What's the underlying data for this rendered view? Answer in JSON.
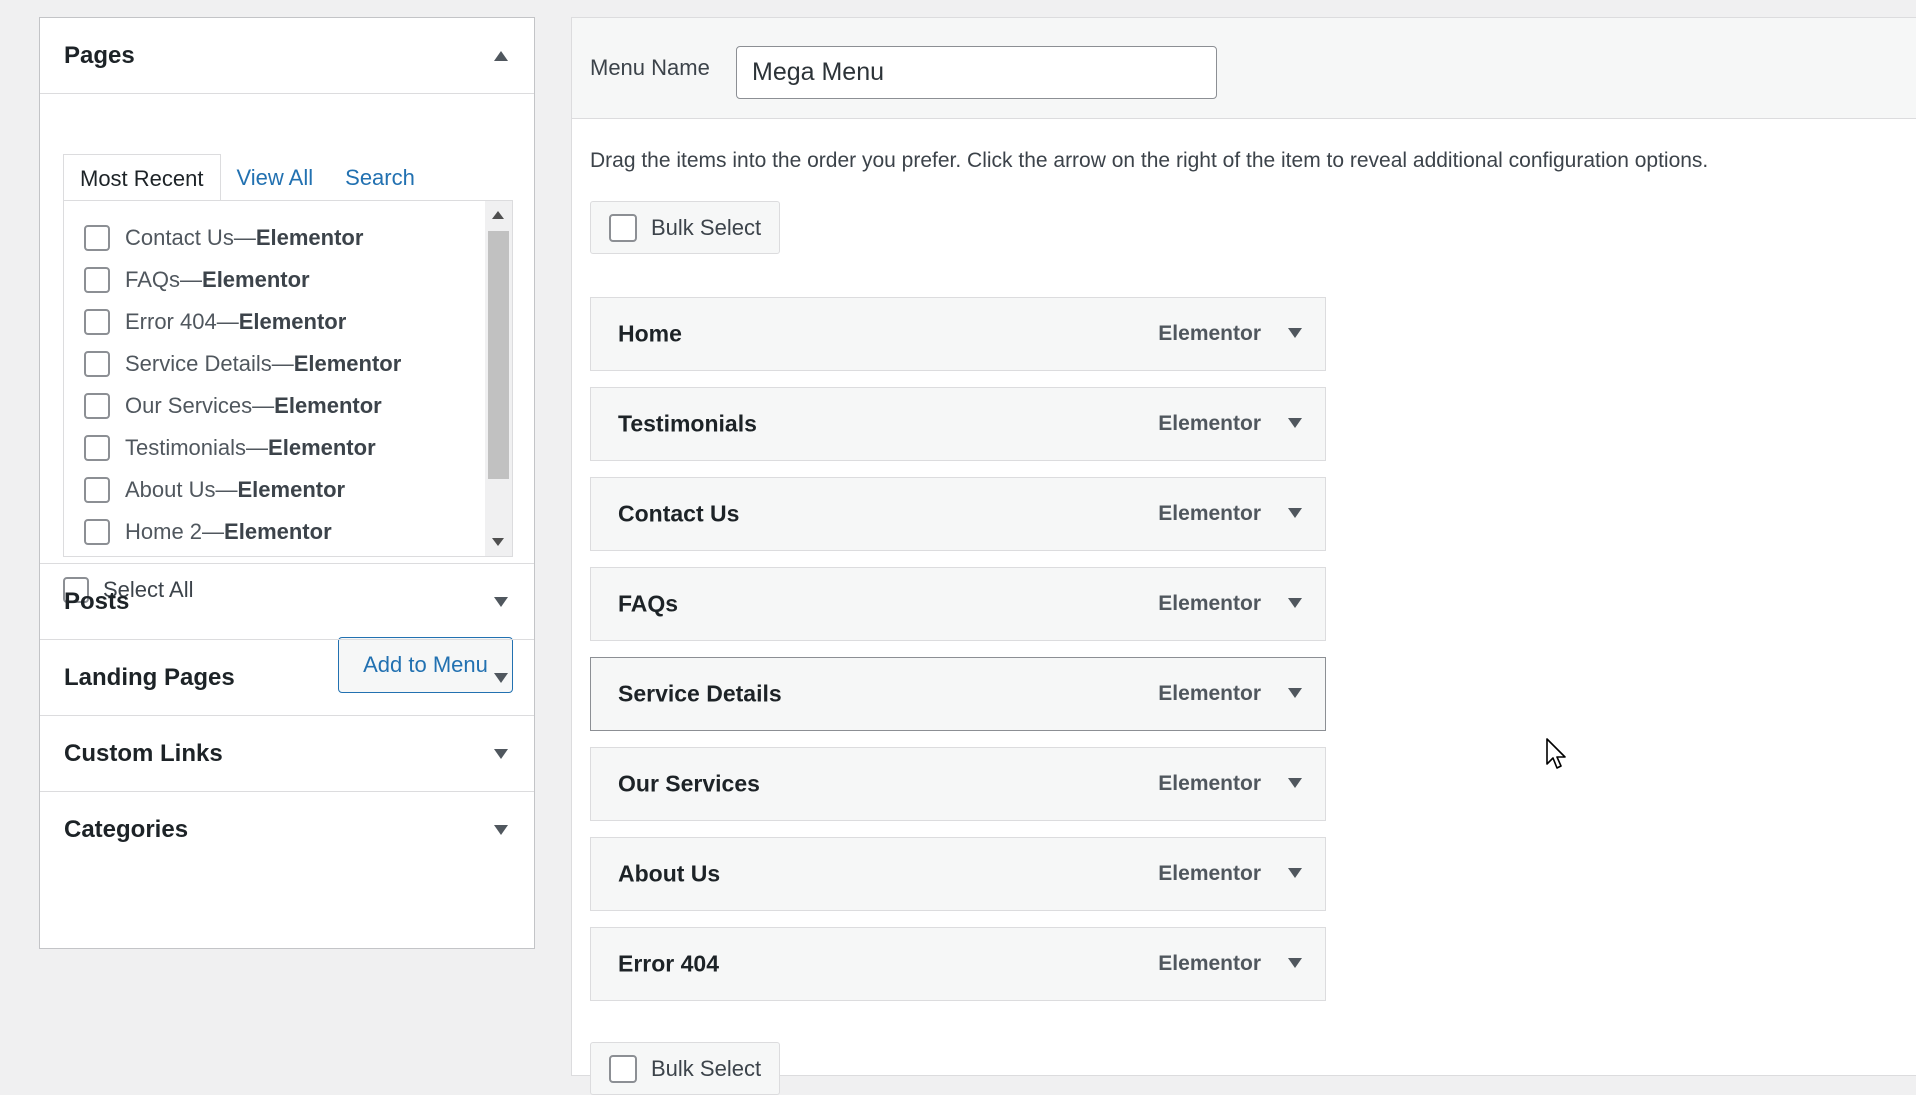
{
  "left": {
    "pages": {
      "title": "Pages",
      "tabs": [
        "Most Recent",
        "View All",
        "Search"
      ],
      "items": [
        {
          "name": "Contact Us",
          "suffix": "Elementor"
        },
        {
          "name": "FAQs",
          "suffix": "Elementor"
        },
        {
          "name": "Error 404",
          "suffix": "Elementor"
        },
        {
          "name": "Service Details",
          "suffix": "Elementor"
        },
        {
          "name": "Our Services",
          "suffix": "Elementor"
        },
        {
          "name": "Testimonials",
          "suffix": "Elementor"
        },
        {
          "name": "About Us",
          "suffix": "Elementor"
        },
        {
          "name": "Home 2",
          "suffix": "Elementor"
        }
      ],
      "separator": " — ",
      "select_all": "Select All",
      "add_button": "Add to Menu"
    },
    "sections": [
      "Posts",
      "Landing Pages",
      "Custom Links",
      "Categories"
    ]
  },
  "right": {
    "menu_name_label": "Menu Name",
    "menu_name_value": "Mega Menu",
    "instructions": "Drag the items into the order you prefer. Click the arrow on the right of the item to reveal additional configuration options.",
    "bulk_select": "Bulk Select",
    "menu_items": [
      {
        "title": "Home",
        "type": "Elementor"
      },
      {
        "title": "Testimonials",
        "type": "Elementor"
      },
      {
        "title": "Contact Us",
        "type": "Elementor"
      },
      {
        "title": "FAQs",
        "type": "Elementor"
      },
      {
        "title": "Service Details",
        "type": "Elementor"
      },
      {
        "title": "Our Services",
        "type": "Elementor"
      },
      {
        "title": "About Us",
        "type": "Elementor"
      },
      {
        "title": "Error 404",
        "type": "Elementor"
      }
    ]
  }
}
